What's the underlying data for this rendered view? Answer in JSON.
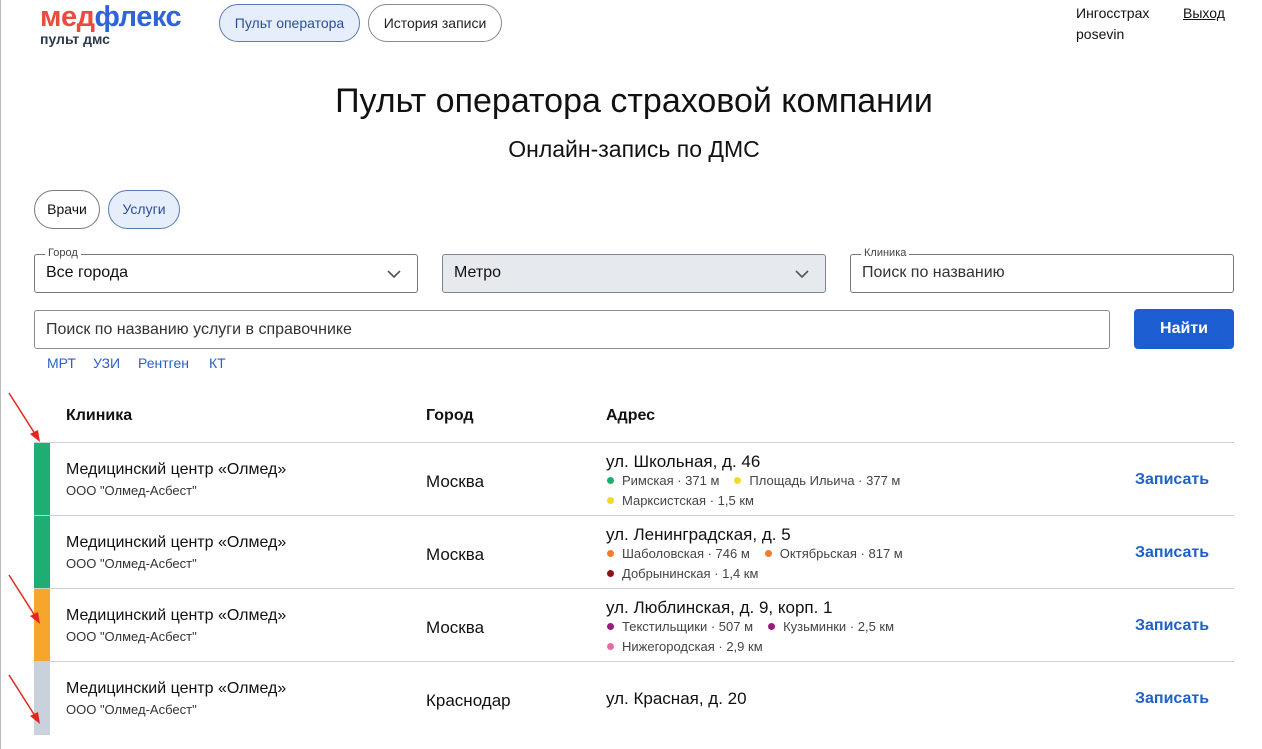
{
  "header": {
    "logo_main_a": "мед",
    "logo_main_b": "флекс",
    "logo_sub": "пульт дмс",
    "nav": [
      {
        "label": "Пульт оператора",
        "active": true
      },
      {
        "label": "История записи",
        "active": false
      }
    ],
    "user": {
      "company": "Ингосстрах",
      "login": "posevin"
    },
    "logout_label": "Выход"
  },
  "page": {
    "title": "Пульт оператора страховой компании",
    "subtitle": "Онлайн-запись по ДМС"
  },
  "mode_chips": [
    {
      "label": "Врачи",
      "active": false
    },
    {
      "label": "Услуги",
      "active": true
    }
  ],
  "filters": {
    "city": {
      "label": "Город",
      "value": "Все города"
    },
    "metro": {
      "value": "Метро"
    },
    "clinic": {
      "label": "Клиника",
      "placeholder": "Поиск по названию"
    }
  },
  "service_search": {
    "placeholder": "Поиск по названию услуги в справочнике",
    "button_label": "Найти",
    "quick_links": [
      "МРТ",
      "УЗИ",
      "Рентген",
      "КТ"
    ]
  },
  "table": {
    "columns": [
      "Клиника",
      "Город",
      "Адрес"
    ],
    "book_label": "Записать",
    "rows": [
      {
        "status_color": "#1fad74",
        "clinic": "Медицинский центр «Олмед»",
        "org": "ООО \"Олмед-Асбест\"",
        "city": "Москва",
        "address": "ул. Школьная, д. 46",
        "metro_lines": [
          [
            {
              "name": "Римская · 371 м",
              "color": "#1eae6e"
            },
            {
              "name": "Площадь Ильича · 377 м",
              "color": "#f5d92a"
            }
          ],
          [
            {
              "name": "Марксистская · 1,5 км",
              "color": "#f5d92a"
            }
          ]
        ]
      },
      {
        "status_color": "#1fad74",
        "clinic": "Медицинский центр «Олмед»",
        "org": "ООО \"Олмед-Асбест\"",
        "city": "Москва",
        "address": "ул. Ленинградская, д. 5",
        "metro_lines": [
          [
            {
              "name": "Шаболовская · 746 м",
              "color": "#f07d2a"
            },
            {
              "name": "Октябрьская · 817 м",
              "color": "#f07d2a"
            }
          ],
          [
            {
              "name": "Добрынинская · 1,4 км",
              "color": "#8b1414"
            }
          ]
        ]
      },
      {
        "status_color": "#f6a62a",
        "clinic": "Медицинский центр «Олмед»",
        "org": "ООО \"Олмед-Асбест\"",
        "city": "Москва",
        "address": "ул. Люблинская, д. 9, корп. 1",
        "metro_lines": [
          [
            {
              "name": "Текстильщики · 507 м",
              "color": "#9a1a7e"
            },
            {
              "name": "Кузьминки · 2,5 км",
              "color": "#9a1a7e"
            }
          ],
          [
            {
              "name": "Нижегородская · 2,9 км",
              "color": "#e86aa4"
            }
          ]
        ]
      },
      {
        "status_color": "#c9d1dd",
        "clinic": "Медицинский центр «Олмед»",
        "org": "ООО \"Олмед-Асбест\"",
        "city": "Краснодар",
        "address": "ул. Красная, д. 20",
        "metro_lines": []
      }
    ]
  },
  "annotation_arrow_color": "#e3261c"
}
